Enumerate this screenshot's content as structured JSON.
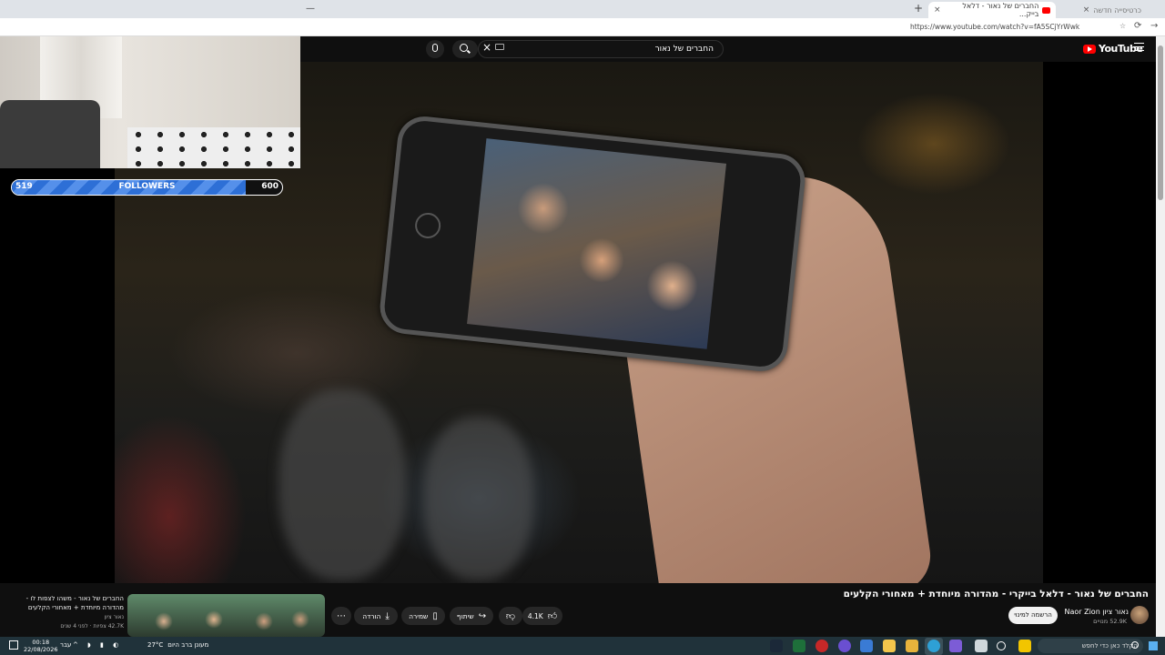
{
  "browser": {
    "active_tab_title": "החברים של נאור - דלאל בייק...",
    "inactive_tab_title": "כרטיסייה חדשה",
    "url": "https://www.youtube.com/watch?v=fA5SCjYrWwk"
  },
  "youtube": {
    "logo_text": "YouTube",
    "search_query": "החברים של נאור"
  },
  "overlay": {
    "followers_label": "FOLLOWERS",
    "followers_current": "519",
    "followers_target": "600",
    "progress_fraction": 0.865
  },
  "video": {
    "title": "החברים של נאור - דלאל בייקרי - מהדורה מיוחדת + מאחורי הקלעים",
    "channel_name": "נאור ציון Naor Zion",
    "subscribers": "52.9K מנויים",
    "subscribe_label": "הרשמה למינוי",
    "like_count": "4.1K",
    "share_label": "שיתוף",
    "save_label": "שמירה",
    "download_label": "הורדה"
  },
  "recommendation": {
    "title": "החברים של נאור - משהו לצפות לו - מהדורה מיוחדת + מאחורי הקלעים",
    "channel": "נאור ציון",
    "meta": "42.7K צפיות · לפני 4 שנים"
  },
  "taskbar": {
    "search_placeholder": "הקלד כאן כדי לחפש",
    "weather_temp": "27°C",
    "weather_condition": "מעונן ברב היום",
    "time": "00:18",
    "date": "22/08/2026",
    "language": "עבר"
  },
  "colors": {
    "followers_fill": "#2d6fd6",
    "youtube_red": "#ff0000",
    "taskbar": "#20323a"
  }
}
